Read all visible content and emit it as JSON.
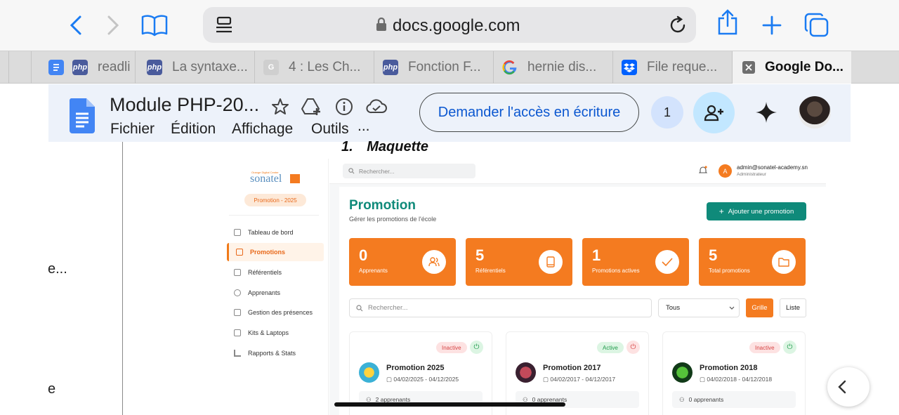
{
  "browser": {
    "url": "docs.google.com",
    "tabs": [
      {
        "label": "readli",
        "favicon": "docs-icon"
      },
      {
        "label": "La syntaxe...",
        "favicon": "php-icon"
      },
      {
        "label": "4 : Les Ch...",
        "favicon": "g-icon"
      },
      {
        "label": "Fonction F...",
        "favicon": "php-icon"
      },
      {
        "label": "hernie dis...",
        "favicon": "google-icon"
      },
      {
        "label": "File reque...",
        "favicon": "dropbox-icon"
      },
      {
        "label": "Google Do...",
        "favicon": "close-icon"
      }
    ],
    "php_fav": "php"
  },
  "docs": {
    "title": "Module PHP-20...",
    "menu": [
      "Fichier",
      "Édition",
      "Affichage",
      "Outils",
      "..."
    ],
    "access_button": "Demander l'accès en écriture",
    "viewer_count": "1"
  },
  "document": {
    "left_fragments": [
      "e...",
      "e"
    ],
    "heading_number": "1.",
    "heading": "Maquette"
  },
  "mockup": {
    "brand_small": "Orange Digital Center",
    "brand": "sonatel",
    "promo_pill": "Promotion - 2025",
    "sidebar": [
      {
        "label": "Tableau de bord",
        "icon": "home-icon"
      },
      {
        "label": "Promotions",
        "icon": "folder-icon",
        "active": true
      },
      {
        "label": "Référentiels",
        "icon": "book-icon"
      },
      {
        "label": "Apprenants",
        "icon": "users-icon"
      },
      {
        "label": "Gestion des présences",
        "icon": "file-icon"
      },
      {
        "label": "Kits & Laptops",
        "icon": "laptop-icon"
      },
      {
        "label": "Rapports & Stats",
        "icon": "chart-icon"
      }
    ],
    "search_placeholder": "Rechercher...",
    "user_initial": "A",
    "user_email": "admin@sonatel-academy.sn",
    "user_role": "Administrateur",
    "page_title": "Promotion",
    "page_subtitle": "Gérer les promotions de l'école",
    "add_button": "Ajouter une promotion",
    "stats": [
      {
        "value": "0",
        "label": "Apprenants",
        "icon": "users-icon"
      },
      {
        "value": "5",
        "label": "Référentiels",
        "icon": "book-icon"
      },
      {
        "value": "1",
        "label": "Promotions actives",
        "icon": "check-icon"
      },
      {
        "value": "5",
        "label": "Total promotions",
        "icon": "folder-icon"
      }
    ],
    "filter_search_placeholder": "Rechercher...",
    "filter_select": "Tous",
    "view_grid": "Grille",
    "view_list": "Liste",
    "promotions": [
      {
        "status": "Inactive",
        "name": "Promotion 2025",
        "dates": "04/02/2025 - 04/12/2025",
        "learners": "2 apprenants",
        "logo_color": "#3bb1d6"
      },
      {
        "status": "Active",
        "name": "Promotion 2017",
        "dates": "04/02/2017 - 04/12/2017",
        "learners": "0 apprenants",
        "logo_color": "#8a2a3a"
      },
      {
        "status": "Inactive",
        "name": "Promotion 2018",
        "dates": "04/02/2018 - 04/12/2018",
        "learners": "0 apprenants",
        "logo_color": "#1f7a2c"
      }
    ]
  },
  "colors": {
    "accent_orange": "#f47b20",
    "teal": "#0f8a7a",
    "docs_blue": "#0b57d0",
    "ios_blue": "#1a7bf2"
  }
}
